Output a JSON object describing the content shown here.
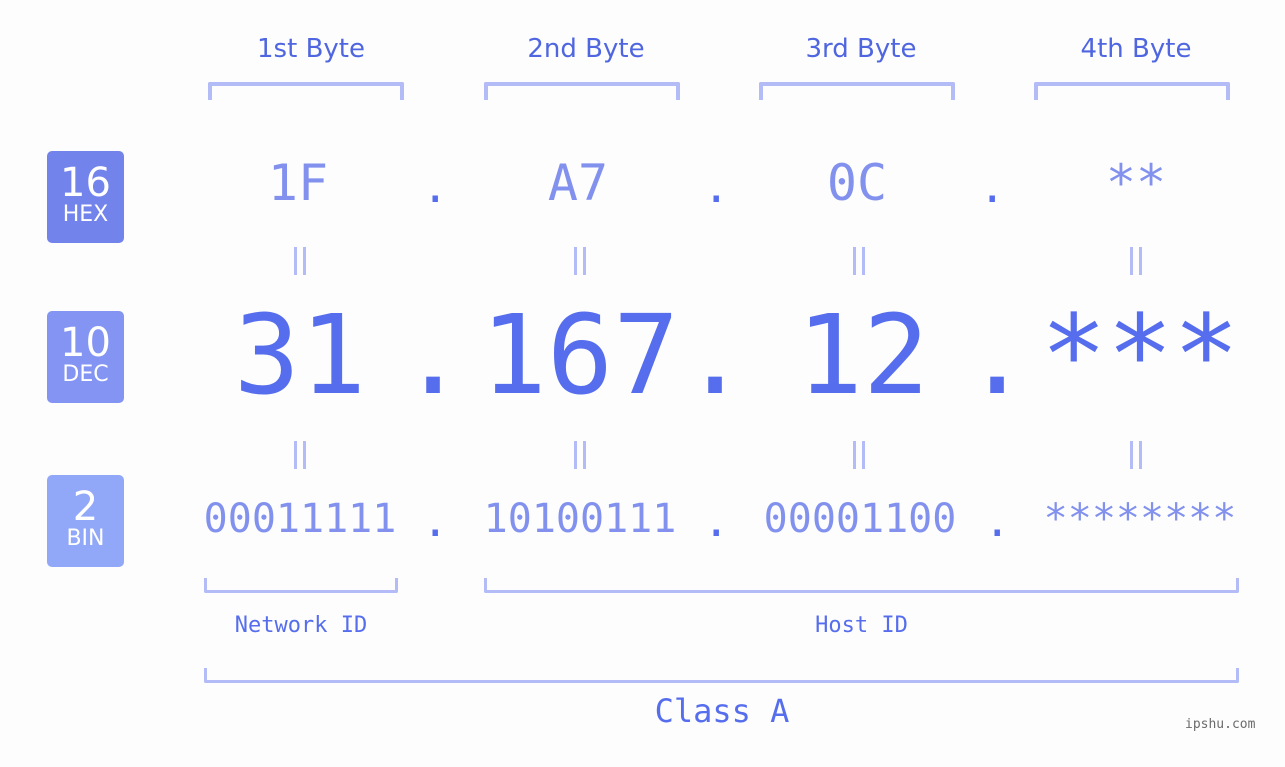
{
  "bytes": [
    {
      "label": "1st Byte",
      "hex": "1F",
      "dec": "31",
      "bin": "00011111"
    },
    {
      "label": "2nd Byte",
      "hex": "A7",
      "dec": "167",
      "bin": "10100111"
    },
    {
      "label": "3rd Byte",
      "hex": "0C",
      "dec": "12",
      "bin": "00001100"
    },
    {
      "label": "4th Byte",
      "hex": "**",
      "dec": "***",
      "bin": "********"
    }
  ],
  "separator": ".",
  "badges": {
    "hex": {
      "num": "16",
      "name": "HEX",
      "color": "#7383ec"
    },
    "dec": {
      "num": "10",
      "name": "DEC",
      "color": "#8394f3"
    },
    "bin": {
      "num": "2",
      "name": "BIN",
      "color": "#91a8f9"
    }
  },
  "network_id_label": "Network ID",
  "host_id_label": "Host ID",
  "class_label": "Class A",
  "watermark": "ipshu.com",
  "colors": {
    "accent": "#566ded",
    "light_accent": "#8291ee",
    "bracket": "#b3bcf7"
  }
}
